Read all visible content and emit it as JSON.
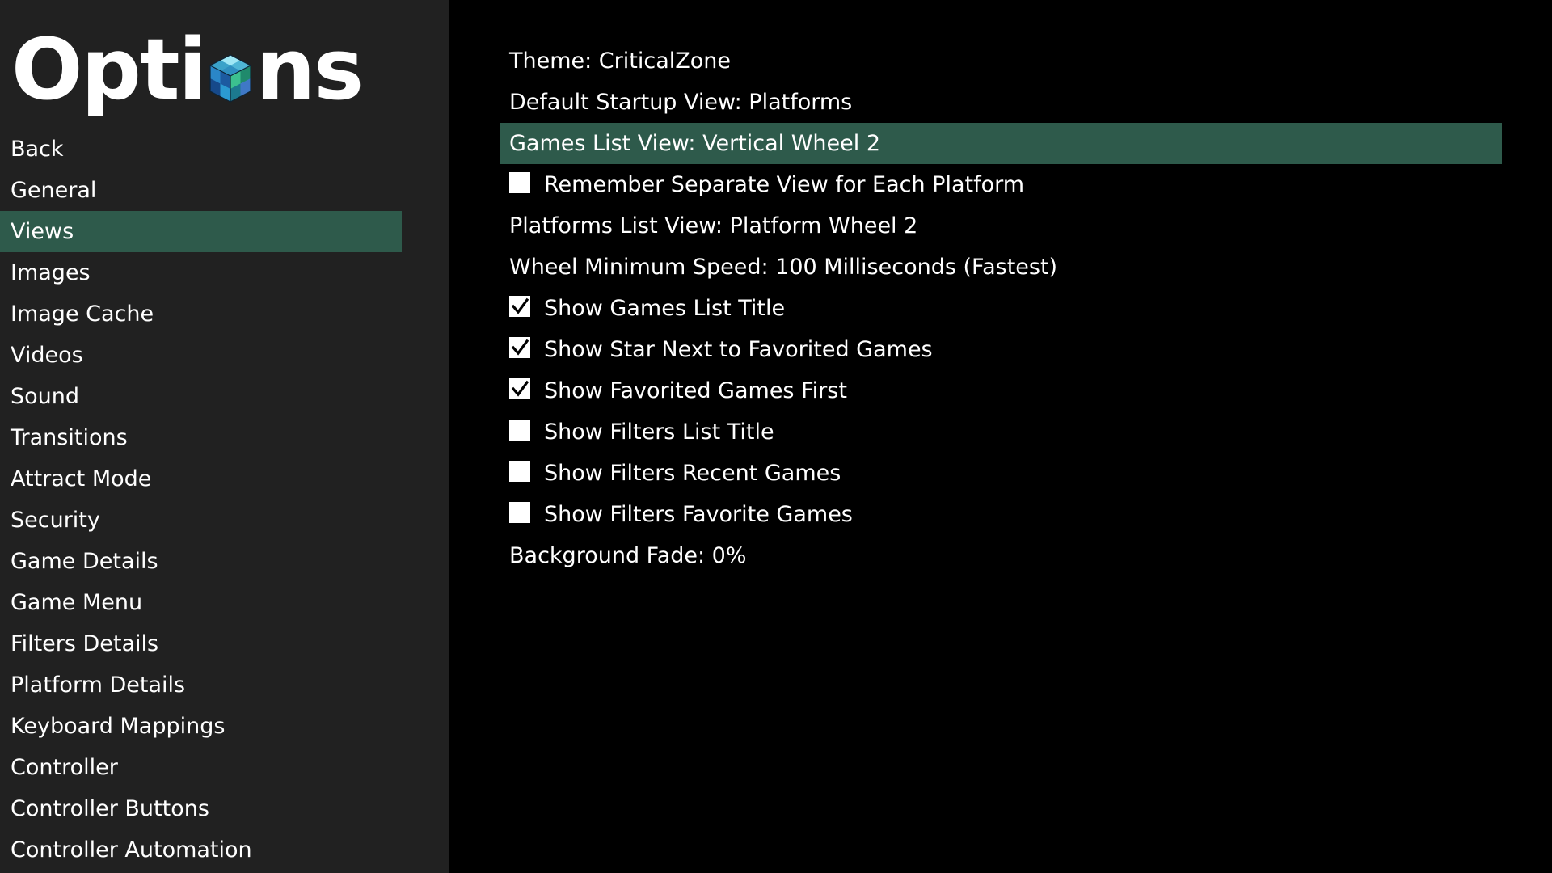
{
  "logo": {
    "text": "Options",
    "part_before": "Opti",
    "part_after": "ns",
    "icon": "cube-icon"
  },
  "colors": {
    "background": "#000000",
    "sidebar_background": "#212121",
    "selected": "#2e5a4b",
    "text": "#ffffff"
  },
  "sidebar": {
    "items": [
      {
        "label": "Back",
        "selected": false
      },
      {
        "label": "General",
        "selected": false
      },
      {
        "label": "Views",
        "selected": true
      },
      {
        "label": "Images",
        "selected": false
      },
      {
        "label": "Image Cache",
        "selected": false
      },
      {
        "label": "Videos",
        "selected": false
      },
      {
        "label": "Sound",
        "selected": false
      },
      {
        "label": "Transitions",
        "selected": false
      },
      {
        "label": "Attract Mode",
        "selected": false
      },
      {
        "label": "Security",
        "selected": false
      },
      {
        "label": "Game Details",
        "selected": false
      },
      {
        "label": "Game Menu",
        "selected": false
      },
      {
        "label": "Filters Details",
        "selected": false
      },
      {
        "label": "Platform Details",
        "selected": false
      },
      {
        "label": "Keyboard Mappings",
        "selected": false
      },
      {
        "label": "Controller",
        "selected": false
      },
      {
        "label": "Controller Buttons",
        "selected": false
      },
      {
        "label": "Controller Automation",
        "selected": false
      }
    ]
  },
  "options": {
    "items": [
      {
        "label": "Theme: CriticalZone",
        "type": "value",
        "selected": false
      },
      {
        "label": "Default Startup View: Platforms",
        "type": "value",
        "selected": false
      },
      {
        "label": "Games List View: Vertical Wheel 2",
        "type": "value",
        "selected": true
      },
      {
        "label": "Remember Separate View for Each Platform",
        "type": "checkbox",
        "checked": false,
        "selected": false
      },
      {
        "label": "Platforms List View: Platform Wheel 2",
        "type": "value",
        "selected": false
      },
      {
        "label": "Wheel Minimum Speed: 100 Milliseconds (Fastest)",
        "type": "value",
        "selected": false
      },
      {
        "label": "Show Games List Title",
        "type": "checkbox",
        "checked": true,
        "selected": false
      },
      {
        "label": "Show Star Next to Favorited Games",
        "type": "checkbox",
        "checked": true,
        "selected": false
      },
      {
        "label": "Show Favorited Games First",
        "type": "checkbox",
        "checked": true,
        "selected": false
      },
      {
        "label": "Show Filters List Title",
        "type": "checkbox",
        "checked": false,
        "selected": false
      },
      {
        "label": "Show Filters Recent Games",
        "type": "checkbox",
        "checked": false,
        "selected": false
      },
      {
        "label": "Show Filters Favorite Games",
        "type": "checkbox",
        "checked": false,
        "selected": false
      },
      {
        "label": "Background Fade: 0%",
        "type": "value",
        "selected": false
      }
    ]
  }
}
